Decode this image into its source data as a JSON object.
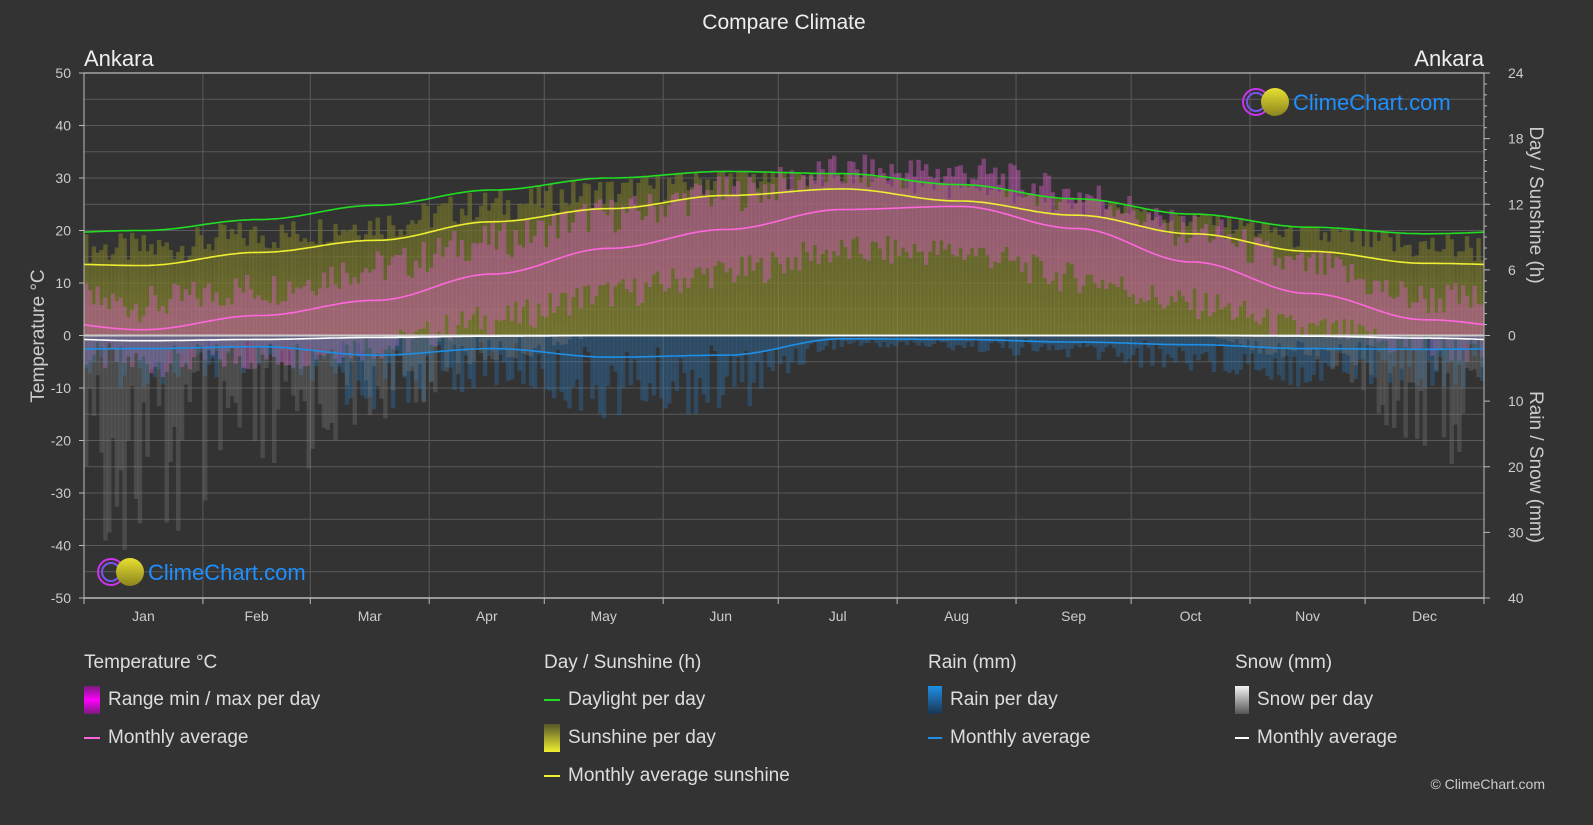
{
  "chart_data": {
    "type": "line",
    "title": "Compare Climate",
    "location_left": "Ankara",
    "location_right": "Ankara",
    "categories": [
      "Jan",
      "Feb",
      "Mar",
      "Apr",
      "May",
      "Jun",
      "Jul",
      "Aug",
      "Sep",
      "Oct",
      "Nov",
      "Dec"
    ],
    "axes": {
      "left": {
        "label": "Temperature °C",
        "range": [
          -50,
          50
        ],
        "ticks": [
          50,
          40,
          30,
          20,
          10,
          0,
          -10,
          -20,
          -30,
          -40,
          -50
        ]
      },
      "right_top": {
        "label": "Day / Sunshine (h)",
        "range": [
          0,
          24
        ],
        "ticks": [
          24,
          18,
          12,
          6,
          0
        ]
      },
      "right_bottom": {
        "label": "Rain / Snow (mm)",
        "range": [
          0,
          40
        ],
        "ticks": [
          0,
          10,
          20,
          30,
          40
        ]
      }
    },
    "grid": true,
    "series": [
      {
        "name": "Temperature monthly average",
        "axis": "left",
        "unit": "°C",
        "color": "#ff66dd",
        "values": [
          1.1,
          3.8,
          6.7,
          11.7,
          16.6,
          20.2,
          24.0,
          24.6,
          20.4,
          14.0,
          8.0,
          3.0
        ]
      },
      {
        "name": "Daylight per day",
        "axis": "right_top",
        "unit": "h",
        "color": "#22dd22",
        "values": [
          9.6,
          10.6,
          11.9,
          13.3,
          14.4,
          15.0,
          14.8,
          13.8,
          12.5,
          11.1,
          9.9,
          9.3
        ]
      },
      {
        "name": "Monthly average sunshine",
        "axis": "right_top",
        "unit": "h",
        "color": "#eeee33",
        "values": [
          6.4,
          7.6,
          8.7,
          10.4,
          11.6,
          12.8,
          13.4,
          12.3,
          11.0,
          9.3,
          7.7,
          6.6
        ]
      },
      {
        "name": "Rain monthly average",
        "axis": "right_bottom",
        "unit": "mm",
        "color": "#1e8fe6",
        "values": [
          2.0,
          1.7,
          3.0,
          2.0,
          3.3,
          3.0,
          0.5,
          0.6,
          1.0,
          1.4,
          2.0,
          2.1
        ]
      },
      {
        "name": "Snow monthly average",
        "axis": "right_bottom",
        "unit": "mm",
        "color": "#ffffff",
        "values": [
          0.8,
          0.6,
          0.3,
          0.1,
          0.0,
          0.0,
          0.0,
          0.0,
          0.0,
          0.0,
          0.1,
          0.4
        ]
      }
    ],
    "ranges": {
      "temperature_min_max": {
        "color": "#dd00dd",
        "min": [
          -5,
          -4,
          -2,
          3,
          8,
          12,
          16,
          16,
          11,
          6,
          1,
          -2
        ],
        "max": [
          6,
          9,
          13,
          18,
          23,
          27,
          31,
          31,
          27,
          20,
          13,
          7
        ]
      }
    }
  },
  "legend": {
    "temperature": {
      "title": "Temperature °C",
      "items": [
        "Range min / max per day",
        "Monthly average"
      ]
    },
    "sunshine": {
      "title": "Day / Sunshine (h)",
      "items": [
        "Daylight per day",
        "Sunshine per day",
        "Monthly average sunshine"
      ]
    },
    "rain": {
      "title": "Rain (mm)",
      "items": [
        "Rain per day",
        "Monthly average"
      ]
    },
    "snow": {
      "title": "Snow (mm)",
      "items": [
        "Snow per day",
        "Monthly average"
      ]
    }
  },
  "logo_text": "ClimeChart.com",
  "copyright": "© ClimeChart.com"
}
